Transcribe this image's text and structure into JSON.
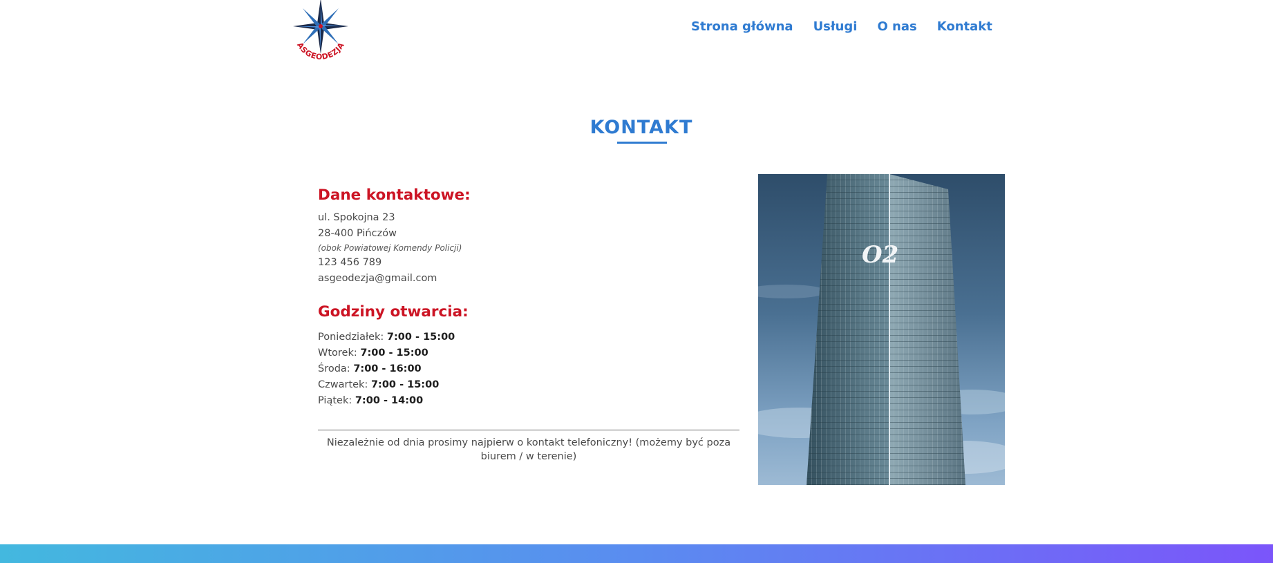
{
  "header": {
    "logo_text": "ASGEODEZJA",
    "nav": [
      {
        "label": "Strona główna"
      },
      {
        "label": "Usługi"
      },
      {
        "label": "O nas"
      },
      {
        "label": "Kontakt"
      }
    ]
  },
  "page": {
    "title": "KONTAKT"
  },
  "contact": {
    "heading": "Dane kontaktowe:",
    "street": "ul. Spokojna 23",
    "city": "28-400 Pińczów",
    "location_note": "(obok Powiatowej Komendy Policji)",
    "phone": "123 456 789",
    "email": "asgeodezja@gmail.com"
  },
  "hours": {
    "heading": "Godziny otwarcia:",
    "days": [
      {
        "day": "Poniedziałek:",
        "time": "7:00 - 15:00"
      },
      {
        "day": "Wtorek:",
        "time": "7:00 - 15:00"
      },
      {
        "day": "Środa:",
        "time": "7:00 - 16:00"
      },
      {
        "day": "Czwartek:",
        "time": "7:00 - 15:00"
      },
      {
        "day": "Piątek:",
        "time": "7:00 - 14:00"
      }
    ]
  },
  "notice": "Niezależnie od dnia prosimy najpierw o kontakt telefoniczny! (możemy być poza biurem / w terenie)",
  "photo": {
    "sign_text": "O2"
  },
  "colors": {
    "brand_blue": "#2f7bd1",
    "heading_red": "#cc1424",
    "gradient_start": "#43b8df",
    "gradient_end": "#7b55fa"
  }
}
